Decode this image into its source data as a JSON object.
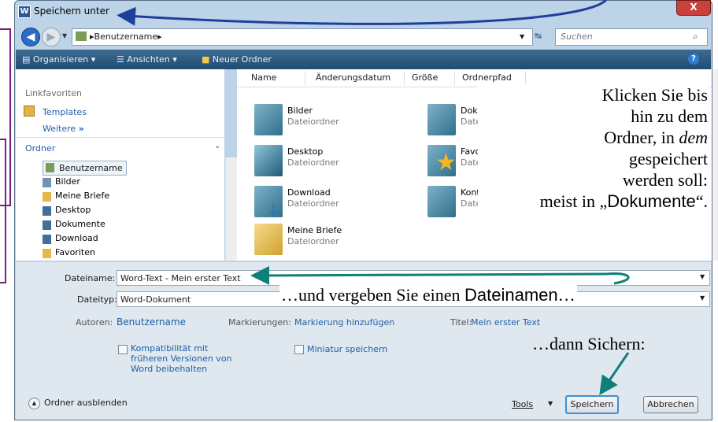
{
  "colors": {
    "annotation_arrow": "#1f3f9a",
    "teal_arrow": "#0f7f7a",
    "toolbar": "#2a5a82"
  },
  "window": {
    "title": "Speichern unter",
    "close_label": "X"
  },
  "address": {
    "crumb": "▸Benutzername▸",
    "search_placeholder": "Suchen"
  },
  "toolbar": {
    "organize": "Organisieren",
    "views": "Ansichten",
    "new_folder": "Neuer Ordner"
  },
  "left": {
    "favorites_heading": "Linkfavoriten",
    "favorites": [
      "Templates"
    ],
    "more": "Weitere",
    "folders_heading": "Ordner",
    "tree_root": "Benutzername",
    "tree": [
      "Bilder",
      "Meine Briefe",
      "Desktop",
      "Dokumente",
      "Download",
      "Favoriten"
    ]
  },
  "columns": [
    "Name",
    "Änderungsdatum",
    "Größe",
    "Ordnerpfad"
  ],
  "files": [
    {
      "name": "Bilder",
      "type": "Dateiordner"
    },
    {
      "name": "Dokumente",
      "type": "Dateiordner"
    },
    {
      "name": "Desktop",
      "type": "Dateiordner"
    },
    {
      "name": "Favoriten",
      "type": "Dateiordner"
    },
    {
      "name": "Download",
      "type": "Dateiordner"
    },
    {
      "name": "Kontakte",
      "type": "Dateiordner"
    },
    {
      "name": "Meine Briefe",
      "type": "Dateiordner"
    }
  ],
  "annotations": {
    "click_lines": [
      "Klicken Sie bis",
      "hin zu dem",
      "Ordner, in ",
      "dem",
      "gespeichert",
      "werden soll:",
      "meist in „",
      "Dokumente",
      "“."
    ],
    "filename_hint": "…und vergeben Sie einen ",
    "filename_hint_word": "Dateinamen",
    "filename_hint_end": "…",
    "save_hint": "…dann Sichern:"
  },
  "form": {
    "filename_label": "Dateiname:",
    "filename_value": "Word-Text - Mein erster Text",
    "filetype_label": "Dateityp:",
    "filetype_value": "Word-Dokument",
    "authors_label": "Autoren:",
    "authors_value": "Benutzername",
    "tags_label": "Markierungen:",
    "tags_value": "Markierung hinzufügen",
    "title_label": "Titel:",
    "title_value": "Mein erster Text",
    "compat_label": "Kompatibilität mit früheren Versionen von Word beibehalten",
    "thumb_label": "Miniatur speichern",
    "hide_folders": "Ordner ausblenden",
    "tools": "Tools",
    "save": "Speichern",
    "cancel": "Abbrechen"
  }
}
